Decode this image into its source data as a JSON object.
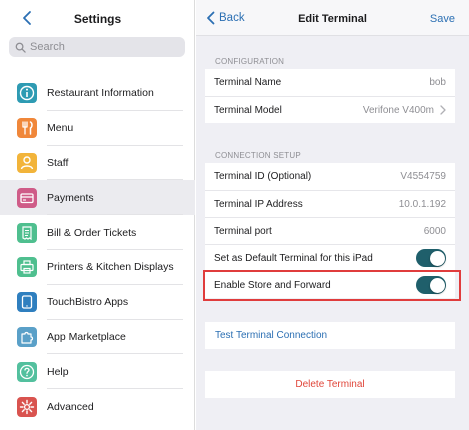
{
  "left": {
    "title": "Settings",
    "search_placeholder": "Search",
    "items": [
      {
        "label": "Restaurant Information",
        "icon": "info-icon",
        "color": "#2e9bb3",
        "selected": false
      },
      {
        "label": "Menu",
        "icon": "utensils-icon",
        "color": "#f0873a",
        "selected": false
      },
      {
        "label": "Staff",
        "icon": "person-icon",
        "color": "#f2b43a",
        "selected": false
      },
      {
        "label": "Payments",
        "icon": "credit-card-icon",
        "color": "#cf5c88",
        "selected": true
      },
      {
        "label": "Bill & Order Tickets",
        "icon": "receipt-icon",
        "color": "#4fbf8f",
        "selected": false
      },
      {
        "label": "Printers & Kitchen Displays",
        "icon": "printer-icon",
        "color": "#4fbf8f",
        "selected": false
      },
      {
        "label": "TouchBistro Apps",
        "icon": "tablet-icon",
        "color": "#2f7fbf",
        "selected": false
      },
      {
        "label": "App Marketplace",
        "icon": "puzzle-icon",
        "color": "#5aa0c8",
        "selected": false
      },
      {
        "label": "Help",
        "icon": "question-icon",
        "color": "#53c09e",
        "selected": false
      },
      {
        "label": "Advanced",
        "icon": "gear-icon",
        "color": "#d9534f",
        "selected": false
      }
    ]
  },
  "right": {
    "back_label": "Back",
    "title": "Edit Terminal",
    "save_label": "Save",
    "configuration": {
      "header": "CONFIGURATION",
      "terminal_name_label": "Terminal Name",
      "terminal_name_value": "bob",
      "terminal_model_label": "Terminal Model",
      "terminal_model_value": "Verifone V400m"
    },
    "connection": {
      "header": "CONNECTION SETUP",
      "terminal_id_label": "Terminal ID (Optional)",
      "terminal_id_value": "V4554759",
      "ip_label": "Terminal IP Address",
      "ip_value": "10.0.1.192",
      "port_label": "Terminal port",
      "port_value": "6000",
      "default_label": "Set as Default Terminal for this iPad",
      "default_on": true,
      "store_forward_label": "Enable Store and Forward",
      "store_forward_on": true
    },
    "test_connection_label": "Test Terminal Connection",
    "delete_label": "Delete Terminal"
  },
  "colors": {
    "accent": "#2b6fb3",
    "toggle_on": "#1f5f6b",
    "destructive": "#e0463a",
    "highlight": "#e03c3c"
  }
}
